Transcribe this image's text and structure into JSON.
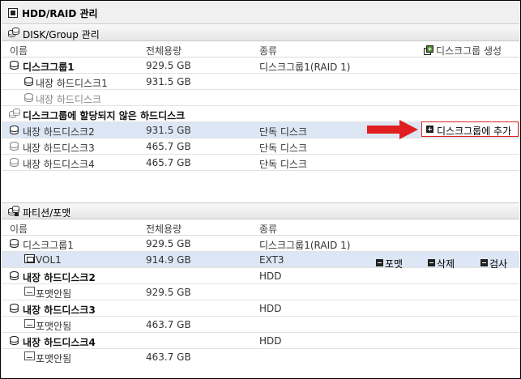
{
  "window": {
    "title": "HDD/RAID 관리"
  },
  "disk_section": {
    "title": "DISK/Group 관리",
    "create_group_label": "디스크그룹 생성",
    "columns": {
      "name": "이름",
      "size": "전체용량",
      "kind": "종류"
    },
    "group_row": {
      "name": "디스크그룹1",
      "size": "929.5 GB",
      "kind": "디스크그룹1(RAID 1)"
    },
    "group_members": [
      {
        "name": "내장 하드디스크1",
        "size": "931.5 GB"
      },
      {
        "name": "내장 하드디스크"
      }
    ],
    "unassigned_title": "디스크그룹에 할당되지 않은 하드디스크",
    "unassigned": [
      {
        "name": "내장 하드디스크2",
        "size": "931.5 GB",
        "kind": "단독 디스크"
      },
      {
        "name": "내장 하드디스크3",
        "size": "465.7 GB",
        "kind": "단독 디스크"
      },
      {
        "name": "내장 하드디스크4",
        "size": "465.7 GB",
        "kind": "단독 디스크"
      }
    ],
    "add_to_group_label": "디스크그룹에 추가"
  },
  "partition_section": {
    "title": "파티션/포맷",
    "columns": {
      "name": "이름",
      "size": "전체용량",
      "kind": "종류"
    },
    "rows": [
      {
        "name": "디스크그룹1",
        "size": "929.5 GB",
        "kind": "디스크그룹1(RAID 1)"
      },
      {
        "name": "VOL1",
        "size": "914.9 GB",
        "kind": "EXT3"
      },
      {
        "name": "내장 하드디스크2",
        "kind": "HDD"
      },
      {
        "name": "포맷안됨",
        "size": "929.5 GB"
      },
      {
        "name": "내장 하드디스크3",
        "kind": "HDD"
      },
      {
        "name": "포맷안됨",
        "size": "463.7 GB"
      },
      {
        "name": "내장 하드디스크4",
        "kind": "HDD"
      },
      {
        "name": "포맷안됨",
        "size": "463.7 GB"
      }
    ],
    "vol_actions": {
      "format": "포맷",
      "delete": "삭제",
      "check": "검사"
    }
  },
  "colors": {
    "selected_row": "#dce6f4",
    "highlight_red": "#e02020"
  }
}
